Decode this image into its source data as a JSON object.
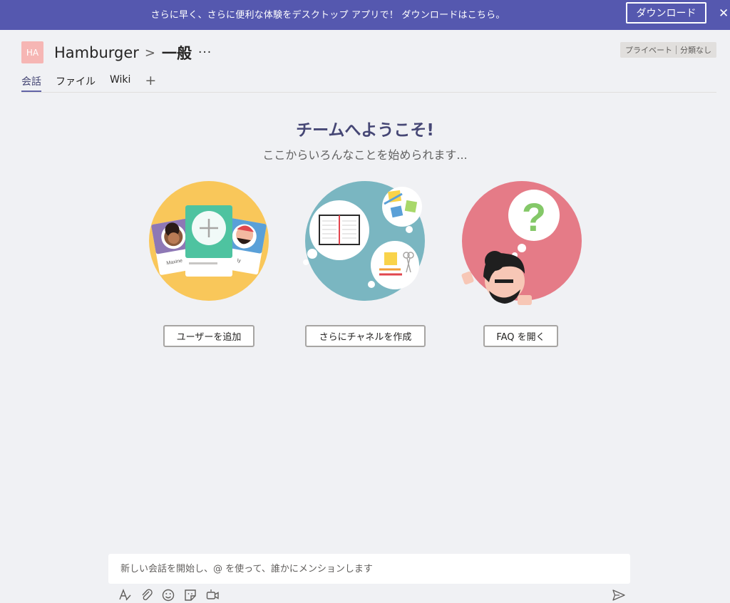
{
  "banner": {
    "text": "さらに早く、さらに便利な体験をデスクトップ アプリで！ ダウンロードはこちら。",
    "button_label": "ダウンロード",
    "close_glyph": "✕",
    "color": "#5558af"
  },
  "header": {
    "avatar_initials": "HA",
    "avatar_color": "#f6b6b4",
    "team_name": "Hamburger",
    "separator": ">",
    "channel_name": "一般",
    "more_label": "···",
    "privacy_label": "プライベート",
    "classification_label": "分類なし"
  },
  "tabs": [
    {
      "label": "会話",
      "active": true
    },
    {
      "label": "ファイル",
      "active": false
    },
    {
      "label": "Wiki",
      "active": false
    }
  ],
  "add_tab_glyph": "+",
  "welcome": {
    "title": "チームへようこそ!",
    "subtitle": "ここからいろんなことを始められます..."
  },
  "cards": [
    {
      "button_label": "ユーザーを追加",
      "illustration_icon": "add-people-illustration",
      "card_names": [
        "Maxine",
        "ly"
      ]
    },
    {
      "button_label": "さらにチャネルを作成",
      "illustration_icon": "channels-illustration"
    },
    {
      "button_label": "FAQ を開く",
      "illustration_icon": "faq-illustration",
      "mark": "?"
    }
  ],
  "composer": {
    "placeholder": "新しい会話を開始し、@ を使って、誰かにメンションします"
  },
  "toolbar": [
    "format-icon",
    "attach-icon",
    "emoji-icon",
    "sticker-icon",
    "meet-now-icon",
    "send-icon"
  ],
  "colors": {
    "accent": "#6264a7",
    "background": "#f0f1f4",
    "illustration_yellow": "#f9c75a",
    "illustration_teal": "#7ab6c1",
    "illustration_pink": "#e57b87"
  }
}
